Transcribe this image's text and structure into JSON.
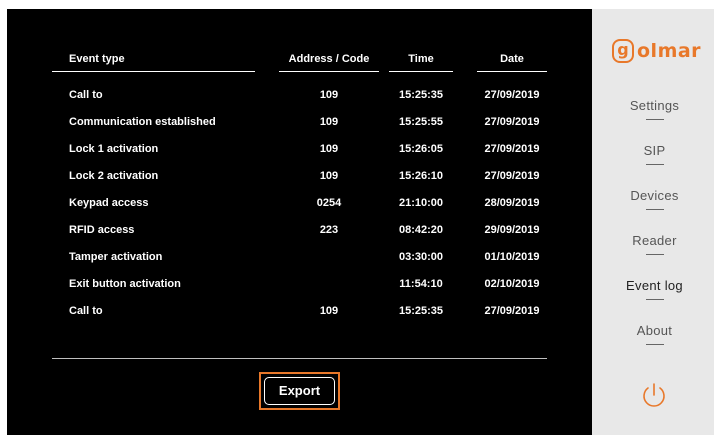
{
  "table": {
    "headers": {
      "event_type": "Event type",
      "address": "Address / Code",
      "time": "Time",
      "date": "Date"
    },
    "rows": [
      {
        "event": "Call to",
        "address": "109",
        "time": "15:25:35",
        "date": "27/09/2019"
      },
      {
        "event": "Communication established",
        "address": "109",
        "time": "15:25:55",
        "date": "27/09/2019"
      },
      {
        "event": "Lock 1 activation",
        "address": "109",
        "time": "15:26:05",
        "date": "27/09/2019"
      },
      {
        "event": "Lock 2 activation",
        "address": "109",
        "time": "15:26:10",
        "date": "27/09/2019"
      },
      {
        "event": "Keypad access",
        "address": "0254",
        "time": "21:10:00",
        "date": "28/09/2019"
      },
      {
        "event": "RFID access",
        "address": "223",
        "time": "08:42:20",
        "date": "29/09/2019"
      },
      {
        "event": "Tamper activation",
        "address": "",
        "time": "03:30:00",
        "date": "01/10/2019"
      },
      {
        "event": "Exit button activation",
        "address": "",
        "time": "11:54:10",
        "date": "02/10/2019"
      },
      {
        "event": "Call to",
        "address": "109",
        "time": "15:25:35",
        "date": "27/09/2019"
      }
    ]
  },
  "export_label": "Export",
  "logo": {
    "letter": "g",
    "text": "olmar"
  },
  "nav": [
    {
      "label": "Settings",
      "active": false
    },
    {
      "label": "SIP",
      "active": false
    },
    {
      "label": "Devices",
      "active": false
    },
    {
      "label": "Reader",
      "active": false
    },
    {
      "label": "Event log",
      "active": true
    },
    {
      "label": "About",
      "active": false
    }
  ],
  "icons": {
    "power": "power-icon"
  },
  "colors": {
    "accent": "#e8782a",
    "background": "#000000",
    "sidebar": "#e8e8e8",
    "text": "#ffffff"
  }
}
